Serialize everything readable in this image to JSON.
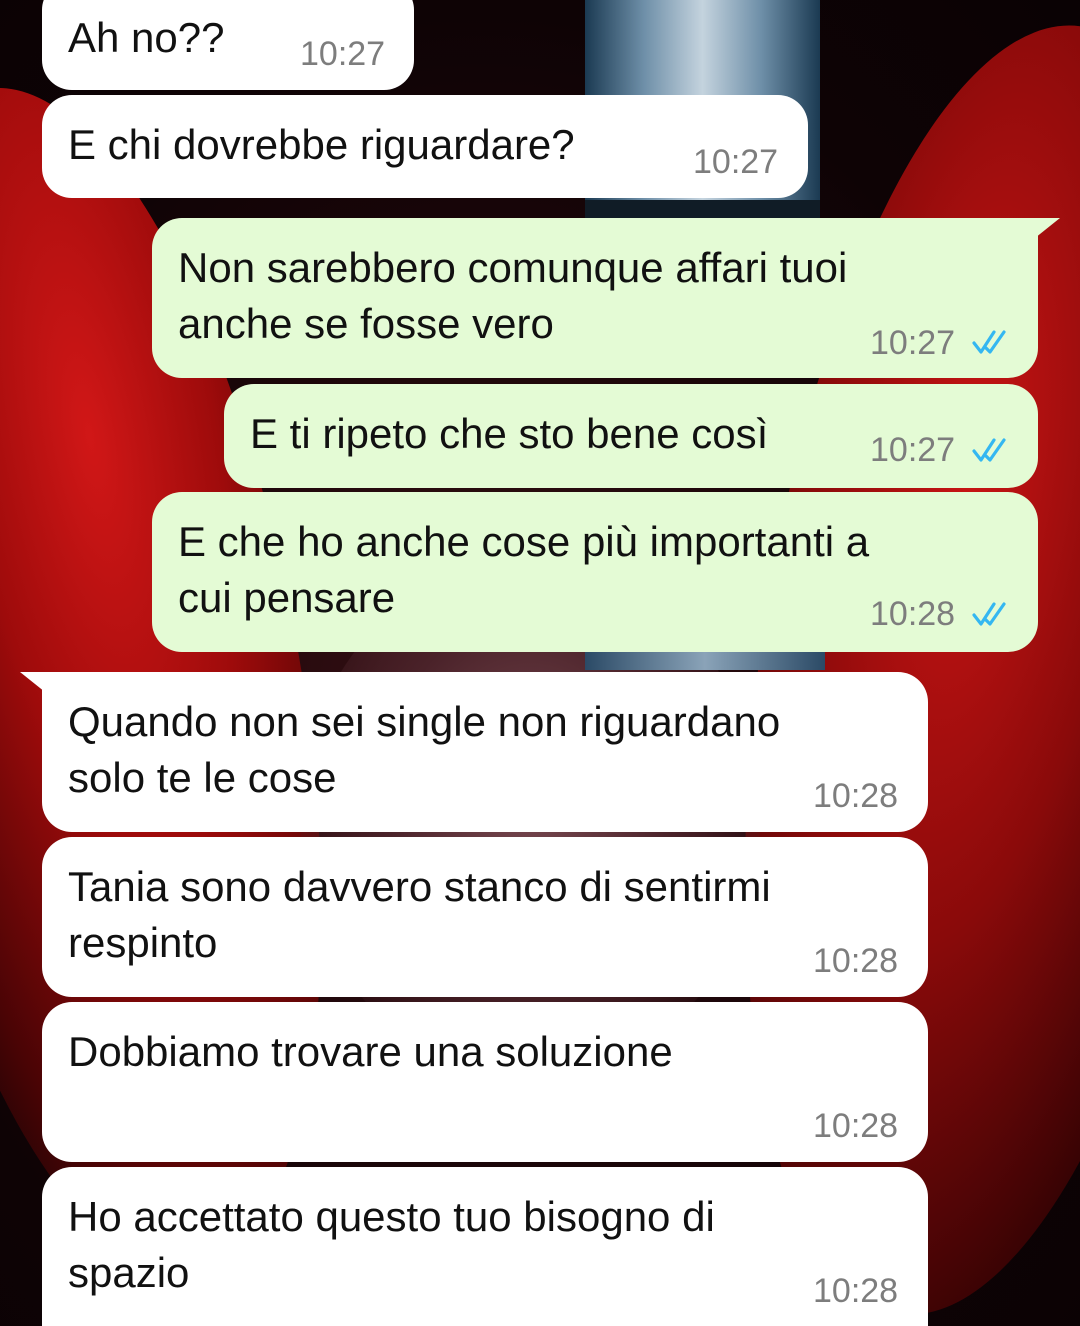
{
  "colors": {
    "incoming_bubble": "#ffffff",
    "outgoing_bubble": "#e4fbd5",
    "timestamp": "#7d7d7d",
    "read_ticks": "#34b7f1"
  },
  "messages": [
    {
      "direction": "incoming",
      "lines": [
        "Ah no??"
      ],
      "time": "10:27"
    },
    {
      "direction": "incoming",
      "lines": [
        "E chi dovrebbe riguardare?"
      ],
      "time": "10:27"
    },
    {
      "direction": "outgoing",
      "lines": [
        "Non sarebbero comunque affari tuoi",
        "anche se fosse vero"
      ],
      "time": "10:27",
      "status_icon": "double-check-read-icon"
    },
    {
      "direction": "outgoing",
      "lines": [
        "E ti ripeto che sto bene così"
      ],
      "time": "10:27",
      "status_icon": "double-check-read-icon"
    },
    {
      "direction": "outgoing",
      "lines": [
        "E che ho anche cose più importanti a",
        "cui pensare"
      ],
      "time": "10:28",
      "status_icon": "double-check-read-icon"
    },
    {
      "direction": "incoming",
      "lines": [
        "Quando non sei single non riguardano",
        "solo te le cose"
      ],
      "time": "10:28"
    },
    {
      "direction": "incoming",
      "lines": [
        "Tania sono davvero stanco di sentirmi",
        "respinto"
      ],
      "time": "10:28"
    },
    {
      "direction": "incoming",
      "lines": [
        "Dobbiamo trovare una soluzione"
      ],
      "time": "10:28"
    },
    {
      "direction": "incoming",
      "lines": [
        "Ho accettato questo tuo bisogno di",
        "spazio"
      ],
      "time": "10:28"
    }
  ]
}
